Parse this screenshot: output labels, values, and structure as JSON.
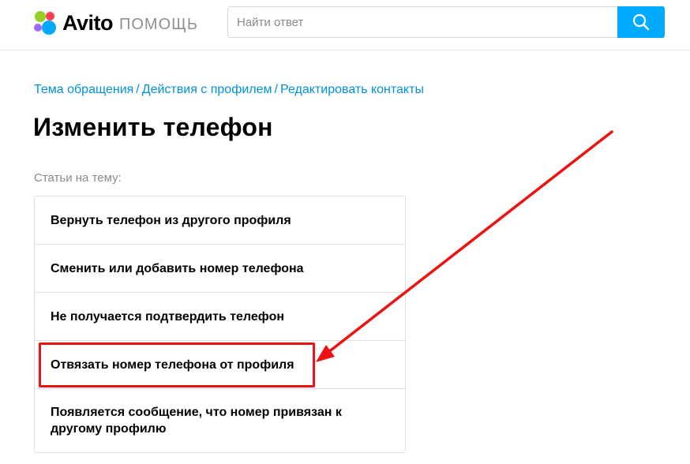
{
  "header": {
    "logo_word": "Avito",
    "logo_sub": "ПОМОЩЬ",
    "search_placeholder": "Найти ответ",
    "search_value": ""
  },
  "breadcrumb": [
    "Тема обращения",
    "Действия с профилем",
    "Редактировать контакты"
  ],
  "breadcrumb_separator": "/",
  "page_title": "Изменить телефон",
  "related_label": "Статьи на тему:",
  "articles": [
    "Вернуть телефон из другого профиля",
    "Сменить или добавить номер телефона",
    "Не получается подтвердить телефон",
    "Отвязать номер телефона от профиля",
    "Появляется сообщение, что номер привязан к другому профилю"
  ],
  "colors": {
    "accent": "#00aaff",
    "link": "#0091d9",
    "annotation": "#ee1111"
  }
}
